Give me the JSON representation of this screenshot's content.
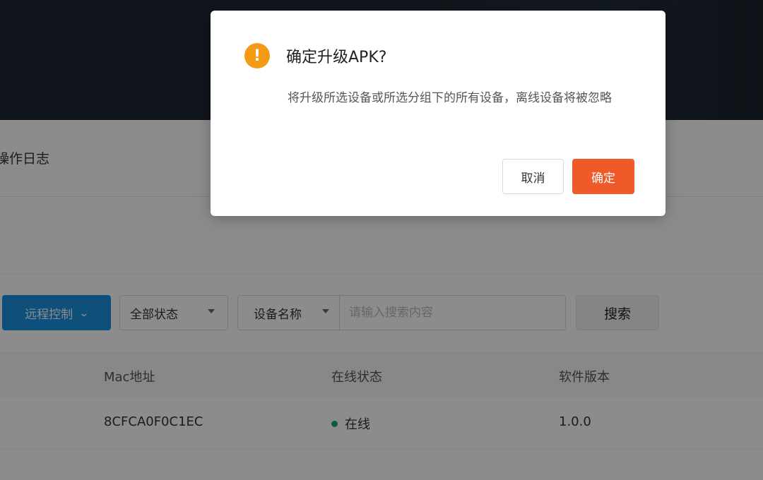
{
  "background": {
    "tabs": {
      "operation_log": "操作日志"
    },
    "toolbar": {
      "remote_control_label": "远程控制",
      "status_select_value": "全部状态",
      "search_field_select_value": "设备名称",
      "search_placeholder": "请输入搜索内容",
      "search_button_label": "搜索"
    },
    "table": {
      "columns": [
        "Mac地址",
        "在线状态",
        "软件版本"
      ],
      "rows": [
        {
          "mac": "8CFCA0F0C1EC",
          "status": "在线",
          "version": "1.0.0"
        }
      ]
    }
  },
  "modal": {
    "icon": "warning-exclamation-icon",
    "icon_glyph": "!",
    "title": "确定升级APK?",
    "body": "将升级所选设备或所选分组下的所有设备，离线设备将被忽略",
    "cancel_label": "取消",
    "ok_label": "确定"
  },
  "colors": {
    "primary_blue": "#1a90e0",
    "confirm_orange": "#f05a28",
    "warning_icon": "#f59a14",
    "online_green": "#1aa772"
  }
}
